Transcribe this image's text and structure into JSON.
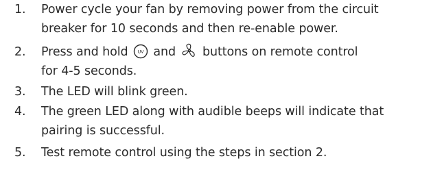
{
  "steps": [
    {
      "number": "1.",
      "lines": [
        "Power cycle your fan by removing power from the circuit",
        "breaker for 10 seconds and then re-enable power."
      ]
    },
    {
      "number": "2.",
      "text_a": "Press and hold",
      "icon_a": "uv-button-icon",
      "text_b": "and",
      "icon_b": "fan-button-icon",
      "text_c": "buttons on remote control",
      "line2": "for 4-5 seconds."
    },
    {
      "number": "3.",
      "lines": [
        "The LED will blink green."
      ]
    },
    {
      "number": "4.",
      "lines": [
        "The green LED along with audible beeps will indicate that",
        "pairing is successful."
      ]
    },
    {
      "number": "5.",
      "lines": [
        "Test remote control using the steps in section 2."
      ]
    }
  ],
  "icons": {
    "uv_label": "UV"
  },
  "colors": {
    "text": "#2b2b2b"
  }
}
